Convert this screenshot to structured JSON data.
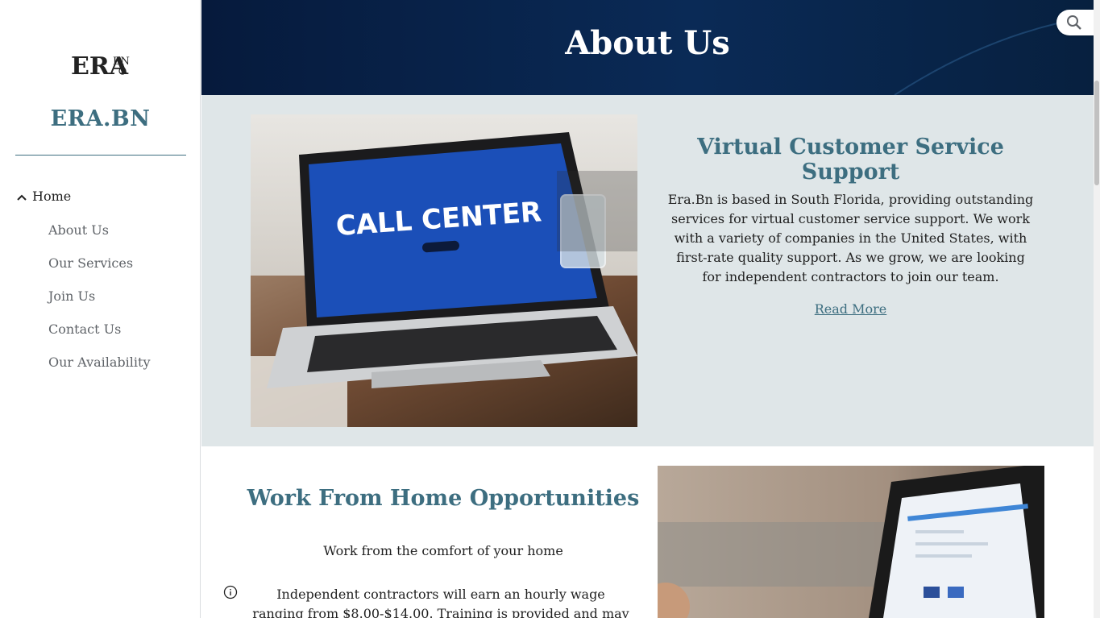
{
  "sidebar": {
    "logo_text_main": "ERA",
    "logo_text_sup": "BN",
    "site_title": "ERA.BN",
    "nav": {
      "home": "Home",
      "items": [
        "About Us",
        "Our Services",
        "Join Us",
        "Contact Us",
        "Our Availability"
      ]
    }
  },
  "header": {
    "title": "About Us"
  },
  "section1": {
    "heading": "Virtual Customer Service Support",
    "body": "Era.Bn is based in South Florida, providing outstanding services for virtual customer service support. We work with a variety of companies in the United States, with first-rate quality support. As we grow, we are looking for independent contractors to join our team.",
    "link": "Read More",
    "image": {
      "screen_text": "CALL CENTER"
    }
  },
  "section2": {
    "heading": "Work From Home Opportunities",
    "subtext": "Work from the comfort of your home",
    "body": "Independent contractors will earn an hourly wage ranging from $8.00-$14.00. Training is provided and may last"
  },
  "icons": {
    "search": "search-icon",
    "chevron": "chevron-up-icon",
    "info": "info-icon"
  },
  "colors": {
    "accent": "#3d6e80",
    "header_bg": "#0a2a56",
    "section_bg": "#dfe6e8"
  }
}
